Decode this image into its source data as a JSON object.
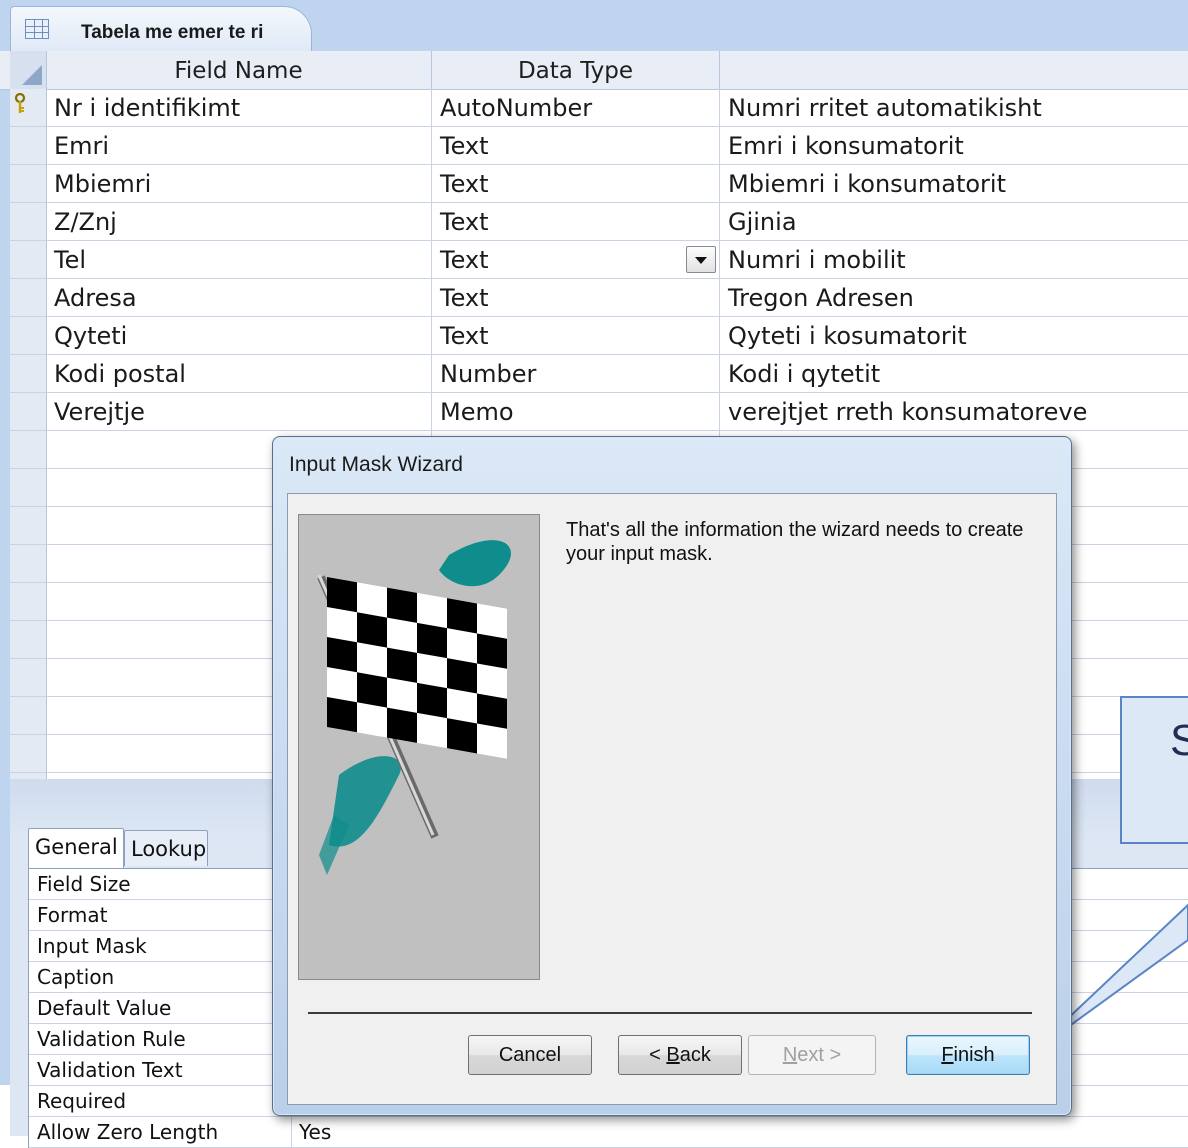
{
  "document_tab": {
    "title": "Tabela me emer te ri"
  },
  "grid": {
    "columns": [
      "Field Name",
      "Data Type",
      ""
    ],
    "rows": [
      {
        "field": "Nr i identifikimt",
        "type": "AutoNumber",
        "description": "Numri rritet automatikisht",
        "primary_key": true
      },
      {
        "field": "Emri",
        "type": "Text",
        "description": "Emri i konsumatorit"
      },
      {
        "field": "Mbiemri",
        "type": "Text",
        "description": "Mbiemri i konsumatorit"
      },
      {
        "field": "Z/Znj",
        "type": "Text",
        "description": "Gjinia"
      },
      {
        "field": "Tel",
        "type": "Text",
        "description": "Numri i mobilit",
        "has_dropdown": true
      },
      {
        "field": "Adresa",
        "type": "Text",
        "description": "Tregon Adresen"
      },
      {
        "field": "Qyteti",
        "type": "Text",
        "description": "Qyteti i kosumatorit"
      },
      {
        "field": "Kodi postal",
        "type": "Number",
        "description": "Kodi i qytetit"
      },
      {
        "field": "Verejtje",
        "type": "Memo",
        "description": "verejtjet rreth konsumatoreve"
      }
    ]
  },
  "properties": {
    "tabs": [
      "General",
      "Lookup"
    ],
    "rows": [
      {
        "label": "Field Size",
        "value": ""
      },
      {
        "label": "Format",
        "value": ""
      },
      {
        "label": "Input Mask",
        "value": ""
      },
      {
        "label": "Caption",
        "value": ""
      },
      {
        "label": "Default Value",
        "value": ""
      },
      {
        "label": "Validation Rule",
        "value": ""
      },
      {
        "label": "Validation Text",
        "value": ""
      },
      {
        "label": "Required",
        "value": ""
      },
      {
        "label": "Allow Zero Length",
        "value": "Yes"
      }
    ]
  },
  "dialog": {
    "title": "Input Mask Wizard",
    "message": "That's all the information the wizard needs to create your input mask.",
    "buttons": {
      "cancel": "Cancel",
      "back_prefix": "< ",
      "back_key": "B",
      "back_rest": "ack",
      "next_key": "N",
      "next_rest": "ext >",
      "finish_key": "F",
      "finish_rest": "inish"
    }
  },
  "callout": {
    "text": "S"
  },
  "colors": {
    "tab_strip": "#bfd4ee",
    "callout_fill": "#dde8f7",
    "callout_border": "#5a84c6",
    "flag_teal": "#0f8c8c"
  }
}
